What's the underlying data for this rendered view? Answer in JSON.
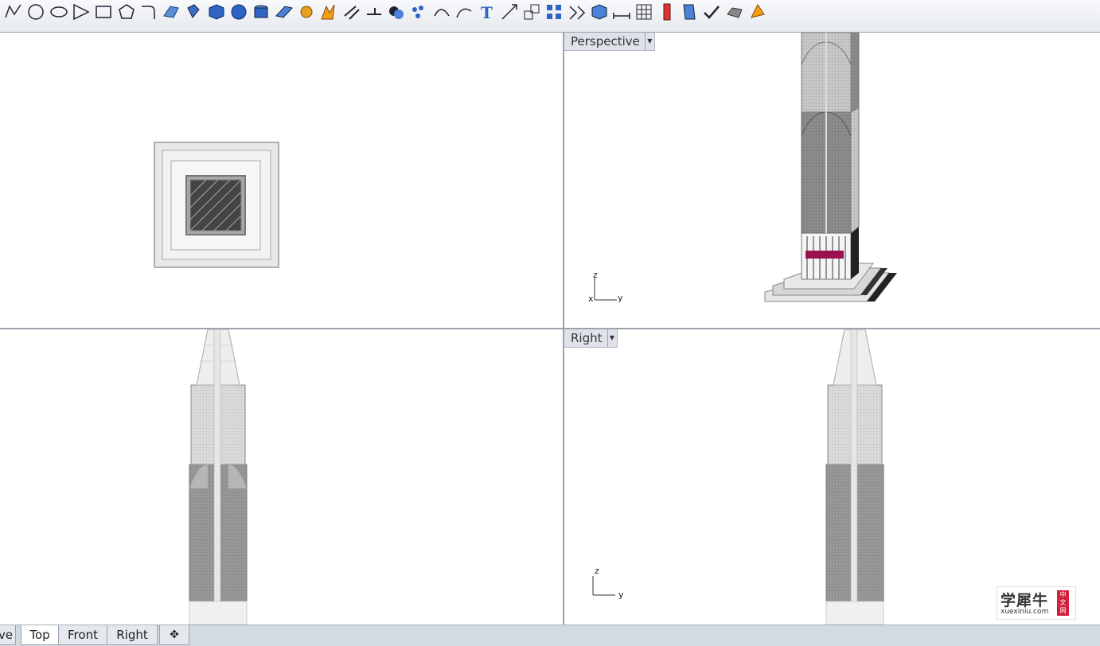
{
  "toolbar": {
    "icons": [
      "polyline-curve-icon",
      "circle-icon",
      "ellipse-icon",
      "polygon-icon",
      "rectangle-icon",
      "polygon-center-icon",
      "fillet-curve-icon",
      "surface-from-points-icon",
      "extrude-icon",
      "box-icon",
      "sphere-icon",
      "cylinder-icon",
      "plane-surface-icon",
      "boolean-gear-icon",
      "split-icon",
      "trim-icon",
      "extend-icon",
      "boolean-union-icon",
      "point-cloud-icon",
      "rebuild-icon",
      "curve-edit-icon",
      "text-icon",
      "move-icon",
      "scale-icon",
      "array-icon",
      "transform-icon",
      "render-box-icon",
      "dimension-icon",
      "grid-icon",
      "analyze-icon",
      "properties-icon",
      "check-icon",
      "shade-icon",
      "material-icon"
    ]
  },
  "viewports": {
    "top": {
      "title": ""
    },
    "perspective": {
      "title": "Perspective"
    },
    "front": {
      "title": ""
    },
    "right": {
      "title": "Right"
    }
  },
  "axes": {
    "z": "z",
    "y": "y",
    "x": "x"
  },
  "tabs": [
    {
      "label": "ve",
      "active": false
    },
    {
      "label": "Top",
      "active": true
    },
    {
      "label": "Front",
      "active": false
    },
    {
      "label": "Right",
      "active": false
    }
  ],
  "watermark": {
    "chinese": "学犀牛",
    "url": "xuexiniu.com",
    "badge": "中文网"
  },
  "colors": {
    "tower_glass": "#8a8a8a",
    "tower_light": "#e8e8e8",
    "accent_lobby": "#9c1050",
    "viewport_bg": "#ffffff",
    "title_bg": "#dfe3e9"
  }
}
